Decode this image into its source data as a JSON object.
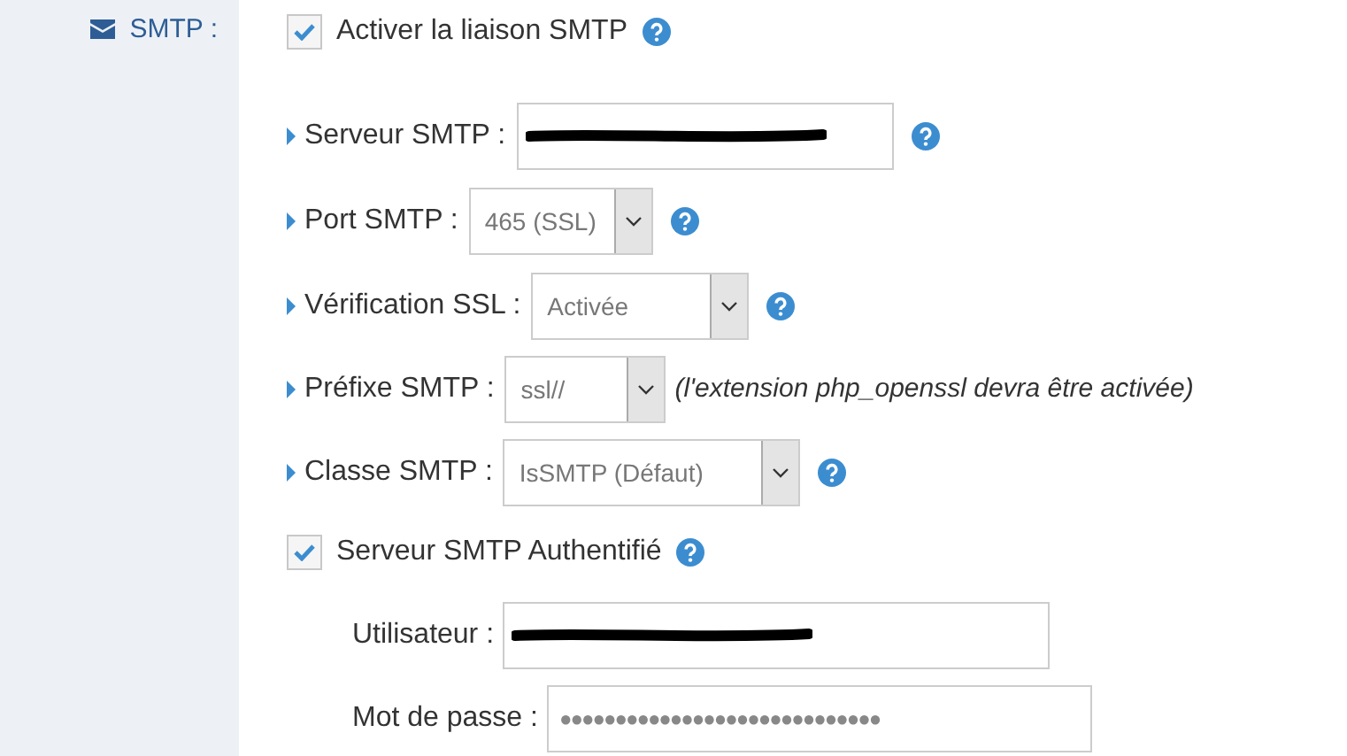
{
  "section": {
    "label": "SMTP :"
  },
  "enable": {
    "label": "Activer la liaison SMTP",
    "checked": true,
    "help": true
  },
  "settings": [
    {
      "kind": "text",
      "label": "Serveur SMTP :",
      "redacted": true,
      "help": true
    },
    {
      "kind": "select",
      "label": "Port SMTP :",
      "value": "465 (SSL)",
      "help": true
    },
    {
      "kind": "select",
      "label": "Vérification SSL :",
      "value": "Activée",
      "help": true
    },
    {
      "kind": "select",
      "label": "Préfixe SMTP :",
      "value": "ssl//",
      "note": "(l'extension php_openssl devra être activée)",
      "help": false
    },
    {
      "kind": "select",
      "label": "Classe SMTP :",
      "value": "IsSMTP (Défaut)",
      "help": true
    }
  ],
  "auth": {
    "label": "Serveur SMTP Authentifié",
    "checked": true,
    "help": true
  },
  "credentials": [
    {
      "kind": "text",
      "label": "Utilisateur :",
      "redacted": true
    },
    {
      "kind": "password",
      "label": "Mot de passe :",
      "value": "●●●●●●●●●●●●●●●●●●●●●●●●●●●●●"
    }
  ]
}
